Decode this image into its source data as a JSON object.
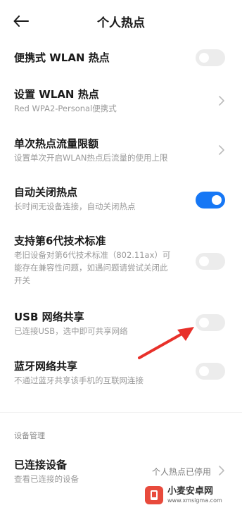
{
  "header": {
    "title": "个人热点"
  },
  "items": [
    {
      "title": "便携式 WLAN 热点"
    },
    {
      "title": "设置 WLAN 热点",
      "subtitle": "Red WPA2-Personal便携式"
    },
    {
      "title": "单次热点流量限额",
      "subtitle": "设置单次开启WLAN热点后流量的使用上限"
    },
    {
      "title": "自动关闭热点",
      "subtitle": "长时间无设备连接，自动关闭热点"
    },
    {
      "title": "支持第6代技术标准",
      "subtitle_lines": [
        "老旧设备对第6代技术标准（802.11ax）可",
        "能存在兼容性问题，如遇问题请尝试关闭此",
        "开关"
      ]
    },
    {
      "title": "USB 网络共享",
      "subtitle": "已连接USB，选中即可共享网络"
    },
    {
      "title": "蓝牙网络共享",
      "subtitle": "不通过蓝牙共享该手机的互联网连接"
    }
  ],
  "section": {
    "label": "设备管理"
  },
  "connected": {
    "title": "已连接设备",
    "subtitle": "查看已连接的设备",
    "value": "个人热点已停用"
  },
  "toggles": {
    "portable": false,
    "auto_off": true,
    "wifi6": false,
    "usb": false,
    "bluetooth": false
  },
  "watermark": {
    "name": "小麦安卓网",
    "url": "www.xmsigma.com"
  },
  "colors": {
    "accent": "#1677f5",
    "arrow": "#e8302a"
  }
}
